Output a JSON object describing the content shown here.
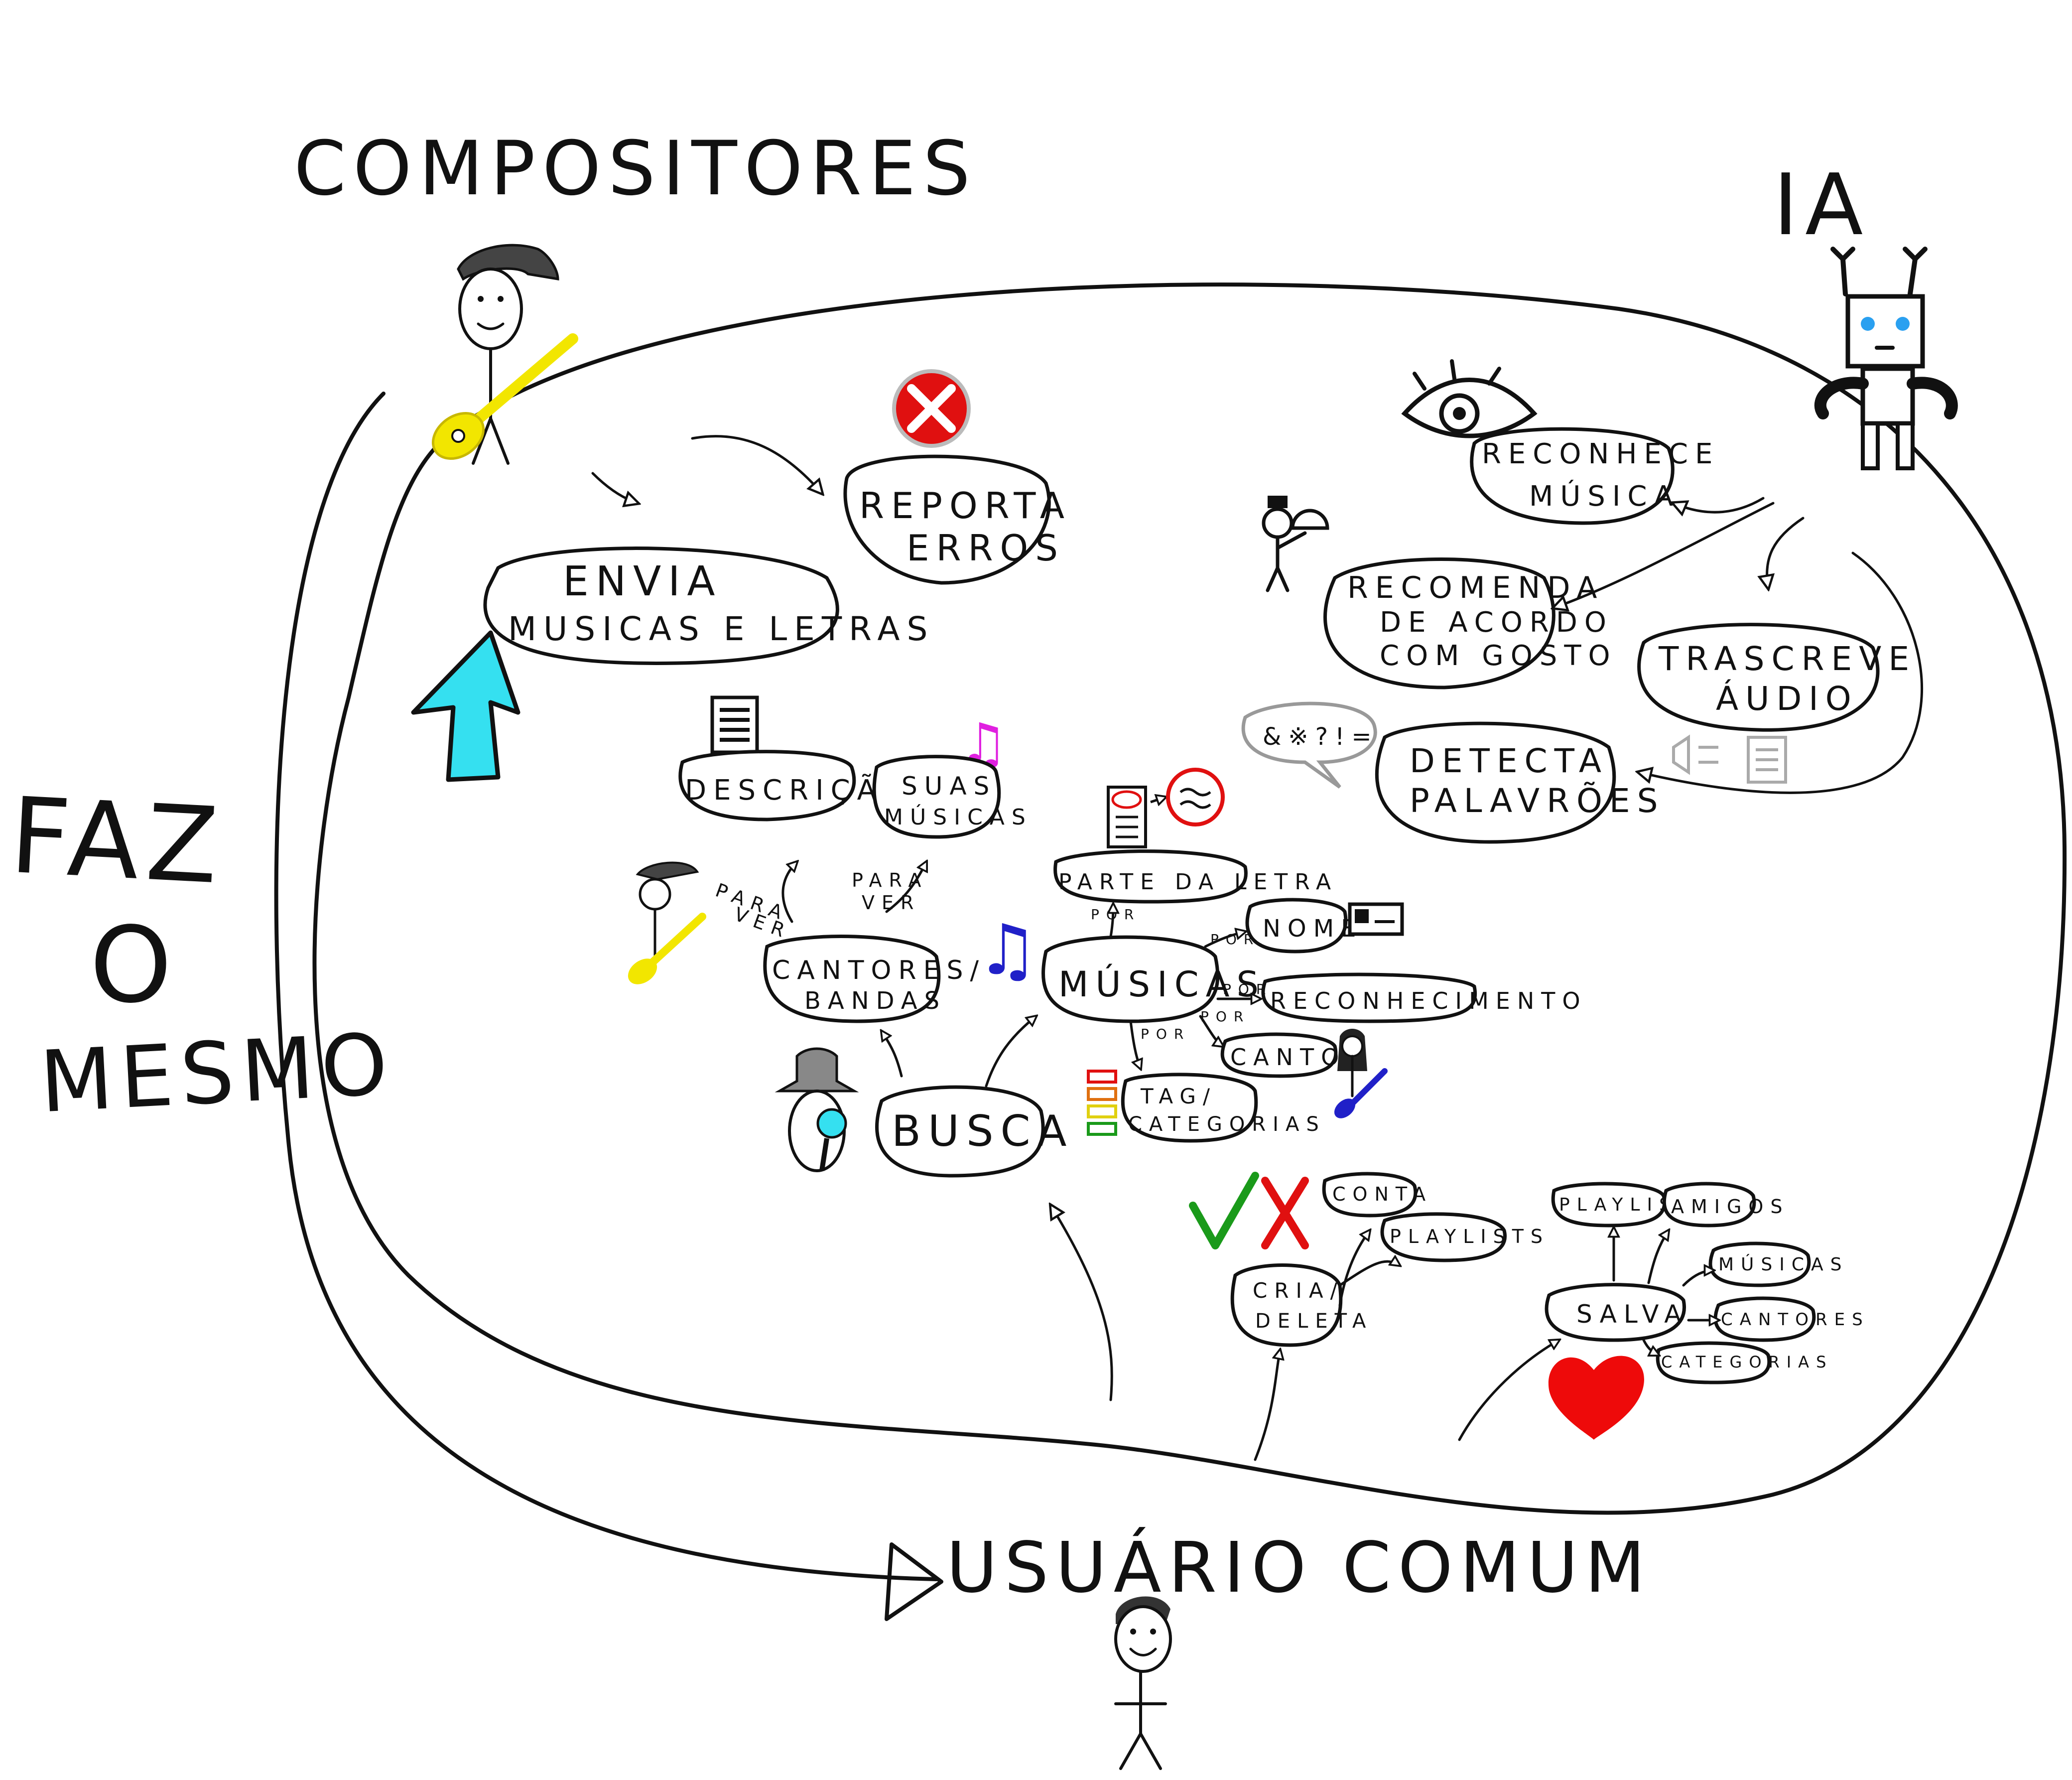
{
  "actors": {
    "compositores": "COMPOSITORES",
    "ia": "IA",
    "usuario": "USUÁRIO COMUM",
    "side_note": [
      "FAZ",
      "O",
      "MESMO"
    ]
  },
  "features": {
    "reporta": [
      "REPORTA",
      "ERROS"
    ],
    "envia": [
      "ENVIA",
      "MUSICAS E LETRAS"
    ],
    "reconhece": [
      "RECONHECE",
      "MÚSICA"
    ],
    "recomenda": [
      "RECOMENDA",
      "DE ACORDO",
      "COM GOSTO"
    ],
    "transcreve": [
      "TRASCREVE",
      "ÁUDIO"
    ],
    "detecta": [
      "DETECTA",
      "PALAVRÕES"
    ],
    "descricao": "DESCRIÇÃO",
    "suas_musicas": [
      "SUAS",
      "MÚSICAS"
    ],
    "cantores_bandas": [
      "CANTORES/",
      "BANDAS"
    ],
    "busca": "BUSCA",
    "musicas": "MÚSICAS",
    "parte_letra": "PARTE DA LETRA",
    "nome": "NOME",
    "reconhecimento": "RECONHECIMENTO",
    "cantor": "CANTOR",
    "tag": [
      "TAG/",
      "CATEGORIAS"
    ],
    "conta": "CONTA",
    "playlists": "PLAYLISTS",
    "cria_deleta": [
      "CRIA/",
      "DELETA"
    ],
    "playlists2": "PLAYLISTS",
    "amigos": "AMIGOS",
    "salva": "SALVA",
    "musicas2": "MÚSICAS",
    "cantores2": "CANTORES",
    "categorias2": "CATEGORIAS"
  },
  "edge_labels": {
    "para_ver_1": [
      "PARA",
      "VER"
    ],
    "para_ver_2": [
      "PARA",
      "VER"
    ],
    "por": "POR"
  },
  "symbols": {
    "swear": "&※?!=",
    "note": "♫",
    "colors": {
      "guitar": "#f2e600",
      "arrow_cyan": "#35e0f0",
      "error_red": "#e01010",
      "note_purple": "#e020e0",
      "note_blue": "#2020c8",
      "robot_eye": "#2aa0f0",
      "heart": "#ee0a0a",
      "check_green": "#1a9a1a"
    }
  }
}
